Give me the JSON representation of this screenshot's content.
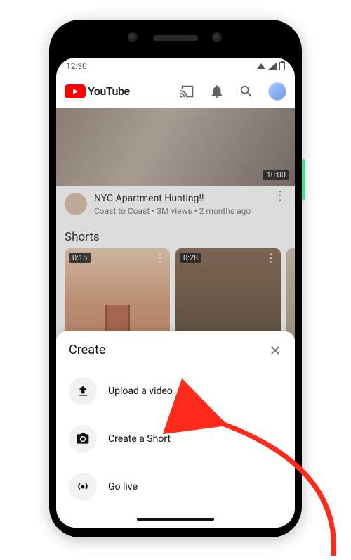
{
  "statusbar": {
    "time": "12:30"
  },
  "header": {
    "brand": "YouTube"
  },
  "video": {
    "duration": "10:00",
    "title": "NYC Apartment Hunting!!",
    "subtitle": "Coast to Coast • 3M views • 2 months ago"
  },
  "shorts": {
    "heading": "Shorts",
    "items": [
      {
        "duration": "0:15"
      },
      {
        "duration": "0:28"
      }
    ]
  },
  "sheet": {
    "title": "Create",
    "items": [
      {
        "label": "Upload a video"
      },
      {
        "label": "Create a Short"
      },
      {
        "label": "Go live"
      }
    ]
  }
}
